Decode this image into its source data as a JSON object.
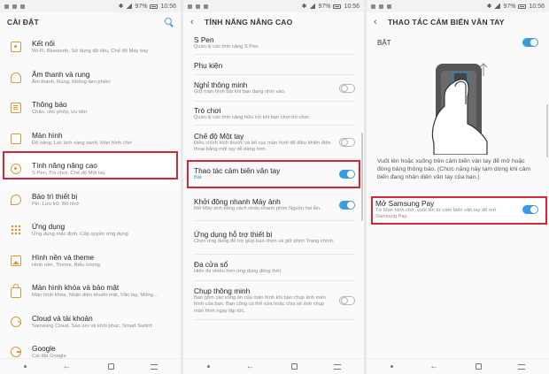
{
  "status": {
    "time": "10:56",
    "battery": "97%"
  },
  "screen1": {
    "title": "CÀI ĐẶT",
    "items": [
      {
        "title": "Kết nối",
        "sub": "Wi-Fi, Bluetooth, Sử dụng dữ liệu, Chế độ Máy bay",
        "icon": "wifi-icon"
      },
      {
        "title": "Âm thanh và rung",
        "sub": "Âm thanh, Rung, Không làm phiền",
        "icon": "sound-icon"
      },
      {
        "title": "Thông báo",
        "sub": "Chặn, cho phép, ưu tiên",
        "icon": "notification-icon"
      },
      {
        "title": "Màn hình",
        "sub": "Độ sáng, Lọc ánh sáng xanh, Màn hình chờ",
        "icon": "display-icon"
      },
      {
        "title": "Tính năng nâng cao",
        "sub": "S Pen, Trò chơi, Chế độ Một tay",
        "icon": "advanced-features-icon"
      },
      {
        "title": "Bảo trì thiết bị",
        "sub": "Pin, Lưu trữ, Bộ nhớ",
        "icon": "device-maintenance-icon"
      },
      {
        "title": "Ứng dụng",
        "sub": "Ứng dụng mặc định, Cấp quyền ứng dụng",
        "icon": "apps-icon"
      },
      {
        "title": "Hình nền và theme",
        "sub": "Hình nền, Theme, Biểu tượng",
        "icon": "wallpaper-icon"
      },
      {
        "title": "Màn hình khóa và bảo mật",
        "sub": "Màn hình khóa, Nhận diện khuôn mặt, Vân tay, Mống...",
        "icon": "lock-icon"
      },
      {
        "title": "Cloud và tài khoản",
        "sub": "Samsung Cloud, Sao lưu và khôi phục, Smart Switch",
        "icon": "key-icon"
      },
      {
        "title": "Google",
        "sub": "Cài đặt Google",
        "icon": "google-icon"
      }
    ]
  },
  "screen2": {
    "title": "TÍNH NĂNG NÂNG CAO",
    "items": [
      {
        "title": "S Pen",
        "sub": "Quản lý các tính năng S Pen."
      },
      {
        "title": "Phụ kiện",
        "sub": ""
      },
      {
        "title": "Nghỉ thông minh",
        "sub": "Giữ màn hình bật khi bạn đang nhìn vào.",
        "toggle": "off"
      },
      {
        "title": "Trò chơi",
        "sub": "Quản lý các tính năng hữu ích khi bạn chơi trò chơi."
      },
      {
        "title": "Chế độ Một tay",
        "sub": "Điều chỉnh kích thước và bố cục màn hình để điều khiển điện thoại bằng một tay dễ dàng hơn.",
        "toggle": "off"
      },
      {
        "title": "Thao tác cảm biến vân tay",
        "sub": "Bật",
        "toggle": "on"
      },
      {
        "title": "Khởi động nhanh Máy ảnh",
        "sub": "Mở Máy ảnh bằng cách nhấn nhanh phím Nguồn hai lần.",
        "toggle": "on"
      },
      {
        "title": "Ứng dụng hỗ trợ thiết bị",
        "sub": "Chọn ứng dụng để trợ giúp bạn chọn và giữ phím Trang chính."
      },
      {
        "title": "Đa cửa sổ",
        "sub": "Hiển thị nhiều hơn ứng dụng đồng thời."
      },
      {
        "title": "Chụp thông minh",
        "sub": "Bao gồm các vùng ẩn của màn hình khi bạn chụp ảnh màn hình của bạn. Bạn cũng có thể sửa hoặc chia sẻ ảnh chụp màn hình ngay lập tức.",
        "toggle": "off"
      }
    ]
  },
  "screen3": {
    "title": "THAO TÁC CẢM BIẾN VÂN TAY",
    "master": "BẬT",
    "description": "Vuốt lên hoặc xuống trên cảm biến vân tay để mở hoặc đóng bảng thông báo. (Chức năng này tạm dừng khi cảm biến đang nhận diện vân tay của bạn.)",
    "pay_title": "Mở Samsung Pay",
    "pay_sub": "Từ Màn hình chờ, vuốt lên từ cảm biến vân tay để mở Samsung Pay."
  },
  "accent": "#3a9be0",
  "highlight": "#d62534"
}
